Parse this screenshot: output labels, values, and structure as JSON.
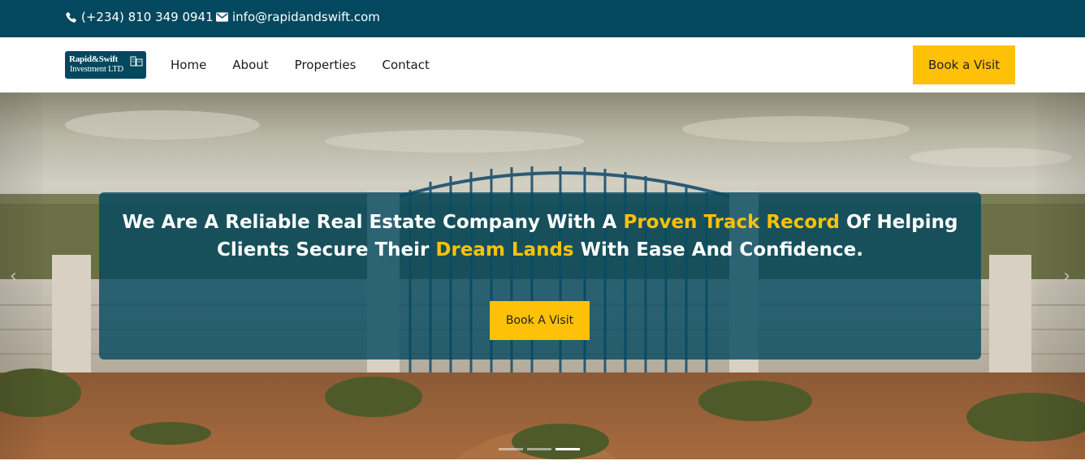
{
  "topbar": {
    "phone": "(+234) 810 349 0941",
    "email": "info@rapidandswift.com",
    "phone_icon": "phone-icon",
    "email_icon": "envelope-icon"
  },
  "logo": {
    "line1": "Rapid&Swift",
    "line2": "Investment LTD"
  },
  "nav": {
    "items": [
      "Home",
      "About",
      "Properties",
      "Contact"
    ],
    "cta": "Book a Visit"
  },
  "hero": {
    "headline_1a": "We Are A Reliable Real Estate Company With A ",
    "headline_1b": "Proven Track Record",
    "headline_1c": " Of Helping",
    "headline_2a": "Clients Secure Their ",
    "headline_2b": "Dream Lands",
    "headline_2c": " With Ease And Confidence.",
    "button": "Book A Visit",
    "prev_icon": "chevron-left-icon",
    "next_icon": "chevron-right-icon",
    "slides": 3,
    "active_slide": 3
  },
  "colors": {
    "brand": "#03485e",
    "accent": "#ffc107"
  }
}
